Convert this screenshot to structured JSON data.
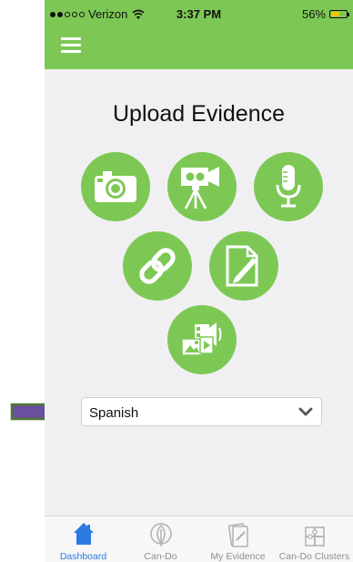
{
  "status_bar": {
    "carrier": "Verizon",
    "time": "3:37 PM",
    "battery": "56%",
    "battery_level": 0.56
  },
  "header": {
    "menu_icon": "hamburger-menu-icon"
  },
  "page": {
    "title": "Upload Evidence"
  },
  "upload_options": [
    {
      "icon": "camera-icon"
    },
    {
      "icon": "video-camera-icon"
    },
    {
      "icon": "microphone-icon"
    },
    {
      "icon": "link-icon"
    },
    {
      "icon": "document-edit-icon"
    },
    {
      "icon": "media-files-icon"
    }
  ],
  "language_select": {
    "value": "Spanish",
    "icon": "chevron-down-icon"
  },
  "tabs": [
    {
      "label": "Dashboard",
      "icon": "home-icon",
      "active": true
    },
    {
      "label": "Can-Do",
      "icon": "leaf-icon",
      "active": false
    },
    {
      "label": "My Evidence",
      "icon": "evidence-icon",
      "active": false
    },
    {
      "label": "Can-Do Clusters",
      "icon": "puzzle-icon",
      "active": false
    }
  ],
  "colors": {
    "brand_green": "#7dc855",
    "active_tab": "#2a7ae2",
    "arrow": "#6a4f9e",
    "arrow_border": "#4b7a32"
  }
}
